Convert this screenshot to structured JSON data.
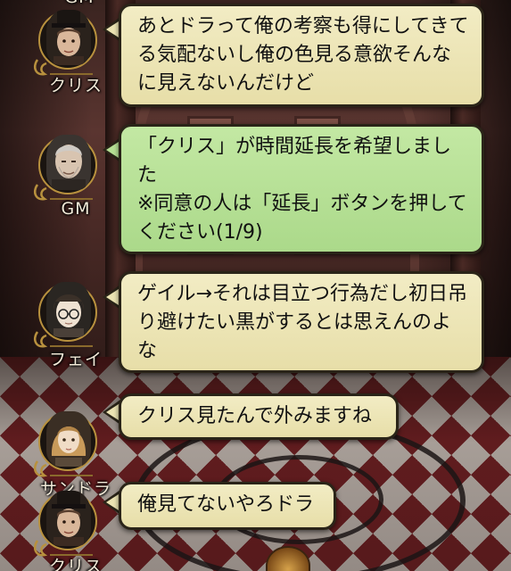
{
  "chat": {
    "messages": [
      {
        "speaker": "クリス",
        "text": "あとドラって俺の考察も得にしてきてる気配ないし俺の色見る意欲そんなに見えないんだけど",
        "bubble_color": "#efe8bd",
        "avatar_icon": "tophat-man-portrait-icon"
      },
      {
        "speaker": "GM",
        "text": "「クリス」が時間延長を希望しました\n※同意の人は「延長」ボタンを押してください(1/9)",
        "bubble_color": "#b9e29a",
        "avatar_icon": "old-man-portrait-icon"
      },
      {
        "speaker": "フェイ",
        "text": "ゲイル→それは目立つ行為だし初日吊り避けたい黒がするとは思えんのよな",
        "bubble_color": "#efe8bd",
        "avatar_icon": "glasses-boy-portrait-icon"
      },
      {
        "speaker": "サンドラ",
        "text": "クリス見たんで外みますね",
        "bubble_color": "#efe8bd",
        "avatar_icon": "blonde-woman-portrait-icon"
      },
      {
        "speaker": "クリス",
        "text": "俺見てないやろドラ",
        "bubble_color": "#efe8bd",
        "avatar_icon": "tophat-man-portrait-icon"
      }
    ],
    "partial_top_name": "GM"
  }
}
